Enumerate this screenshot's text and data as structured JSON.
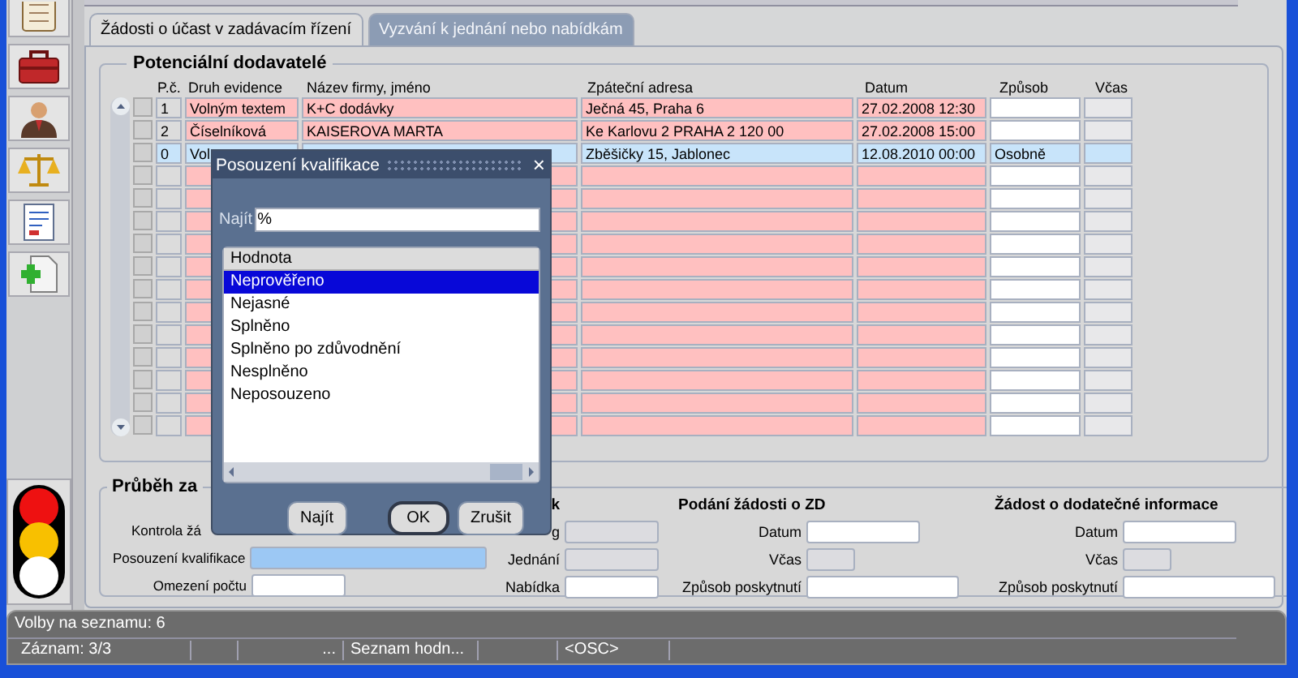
{
  "tabs": [
    {
      "label": "Žádosti o účast v zadávacím řízení",
      "selected": true,
      "disabled": false
    },
    {
      "label": "Vyzvání k jednání nebo nabídkám",
      "selected": false,
      "disabled": true
    }
  ],
  "suppliers": {
    "title": "Potenciální dodavatelé",
    "columns": [
      "P.č.",
      "Druh evidence",
      "Název firmy, jméno",
      "Zpáteční adresa",
      "Datum",
      "Způsob",
      "Včas"
    ],
    "rows": [
      {
        "pc": "1",
        "druh": "Volným textem",
        "nazev": "K+C dodávky",
        "adresa": "Ječná 45, Praha 6",
        "datum": "27.02.2008 12:30",
        "selected": false,
        "checked": false
      },
      {
        "pc": "2",
        "druh": "Číselníková",
        "nazev": "KAISEROVA MARTA",
        "adresa": "Ke Karlovu 2 PRAHA 2 120 00",
        "datum": "27.02.2008 15:00",
        "selected": false,
        "checked": false
      },
      {
        "pc": "0",
        "druh": "Vol",
        "adresa": "Zběšičky 15, Jablonec",
        "datum": "12.08.2010 00:00",
        "zpusob": "Osobně",
        "selected": true,
        "checked": false
      },
      {
        "selected": false,
        "checked": false
      },
      {
        "selected": false,
        "checked": false
      },
      {
        "selected": false,
        "checked": false
      },
      {
        "selected": false,
        "checked": false
      },
      {
        "selected": false,
        "checked": false
      },
      {
        "selected": false,
        "checked": false
      },
      {
        "selected": false,
        "checked": false
      },
      {
        "selected": false,
        "checked": false
      },
      {
        "selected": false,
        "checked": false
      },
      {
        "selected": false,
        "checked": false
      },
      {
        "selected": false,
        "checked": false
      },
      {
        "selected": false,
        "checked": false
      }
    ]
  },
  "progress": {
    "title": "Průběh za",
    "left": [
      {
        "label": "Kontrola žá",
        "kind": "none"
      },
      {
        "label": "Posouzení kvalifikace",
        "kind": "long",
        "focused": true
      },
      {
        "label": "Omezení počtu",
        "kind": "short",
        "focused": false
      }
    ],
    "columns": [
      {
        "heading": "k",
        "kind": "narrow",
        "rows": [
          {
            "label": "g",
            "kind": "short",
            "disabled": true
          },
          {
            "label": "Jednání",
            "kind": "short",
            "disabled": true
          },
          {
            "label": "Nabídka",
            "kind": "short",
            "disabled": false
          }
        ]
      },
      {
        "heading": "Podání žádosti o ZD",
        "kind": "wide",
        "rows": [
          {
            "label": "Datum",
            "kind": "date",
            "disabled": false
          },
          {
            "label": "Včas",
            "kind": "flag",
            "disabled": true
          },
          {
            "label": "Způsob poskytnutí",
            "kind": "text",
            "disabled": false
          }
        ]
      },
      {
        "heading": "Žádost o dodatečné informace",
        "kind": "wide",
        "rows": [
          {
            "label": "Datum",
            "kind": "date",
            "disabled": false
          },
          {
            "label": "Včas",
            "kind": "flag",
            "disabled": true
          },
          {
            "label": "Způsob poskytnutí",
            "kind": "text",
            "disabled": false
          }
        ]
      }
    ]
  },
  "dialog": {
    "title": "Posouzení kvalifikace",
    "close": "×",
    "find_label": "Najít",
    "find_value": "%",
    "list_header": "Hodnota",
    "items": [
      {
        "label": "Neprověřeno",
        "selected": true
      },
      {
        "label": "Nejasné",
        "selected": false
      },
      {
        "label": "Splněno",
        "selected": false
      },
      {
        "label": "Splněno po zdůvodnění",
        "selected": false
      },
      {
        "label": "Nesplněno",
        "selected": false
      },
      {
        "label": "Neposouzeno",
        "selected": false
      }
    ],
    "buttons": [
      {
        "label": "Najít",
        "default": false
      },
      {
        "label": "OK",
        "default": true
      },
      {
        "label": "Zrušit",
        "default": false
      }
    ]
  },
  "status_bar": {
    "message": "Volby na seznamu: 6",
    "segments": [
      {
        "text": "Záznam: 3/3"
      },
      {
        "text": "..."
      },
      {
        "text": "Seznam hodn..."
      },
      {
        "text": "<OSC>"
      }
    ]
  }
}
